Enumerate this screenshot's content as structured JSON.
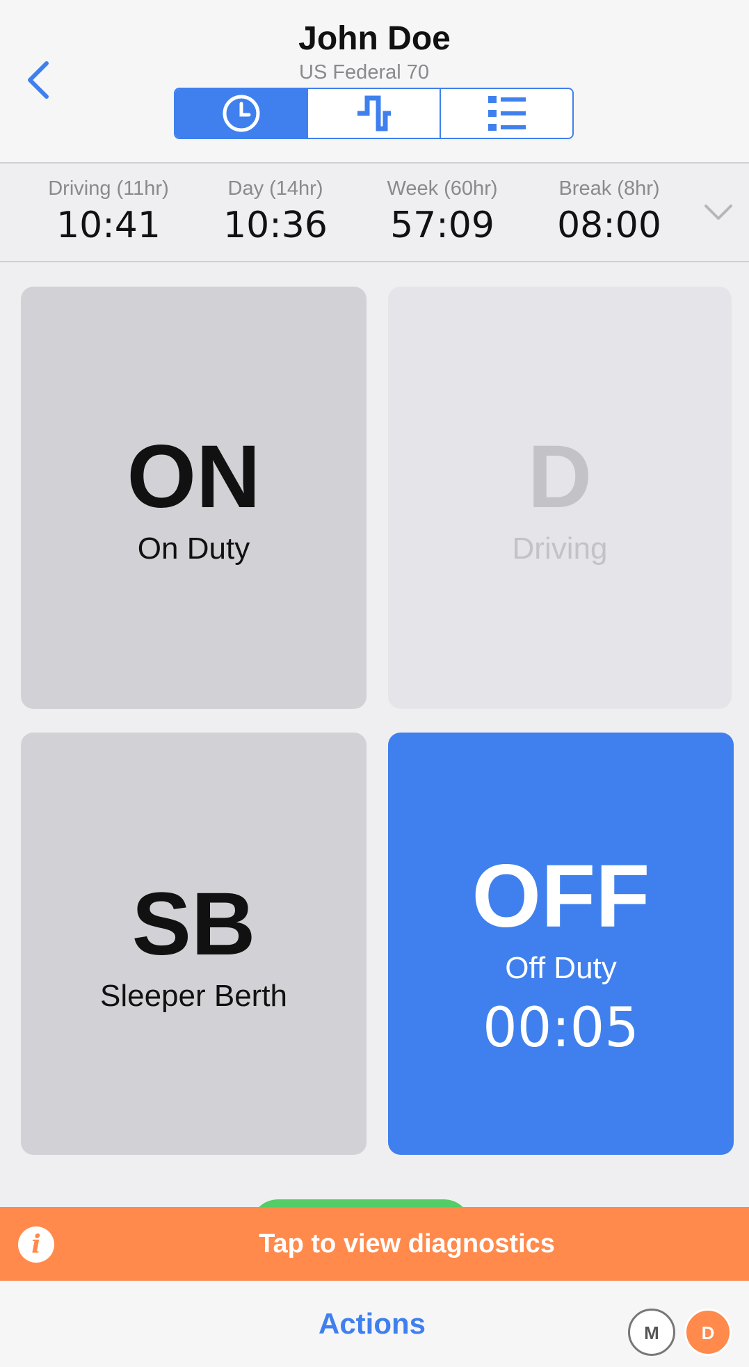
{
  "header": {
    "title": "John Doe",
    "subtitle": "US Federal 70",
    "tabs": [
      {
        "icon": "clock-icon",
        "active": true
      },
      {
        "icon": "log-graph-icon",
        "active": false
      },
      {
        "icon": "list-icon",
        "active": false
      }
    ]
  },
  "timers": [
    {
      "label": "Driving (11hr)",
      "value": "10:41"
    },
    {
      "label": "Day (14hr)",
      "value": "10:36"
    },
    {
      "label": "Week (60hr)",
      "value": "57:09"
    },
    {
      "label": "Break (8hr)",
      "value": "08:00"
    }
  ],
  "statuses": {
    "on": {
      "code": "ON",
      "name": "On Duty"
    },
    "driving": {
      "code": "D",
      "name": "Driving"
    },
    "sleeper": {
      "code": "SB",
      "name": "Sleeper Berth"
    },
    "off": {
      "code": "OFF",
      "name": "Off Duty",
      "elapsed": "00:05"
    }
  },
  "banner": {
    "message": "Tap to view diagnostics",
    "icon": "info-icon"
  },
  "footer": {
    "actions_label": "Actions",
    "badge_m": "M",
    "badge_d": "D"
  },
  "colors": {
    "accent": "#3f80ee",
    "warning": "#ff8a4c",
    "tile": "#d2d2d6"
  }
}
